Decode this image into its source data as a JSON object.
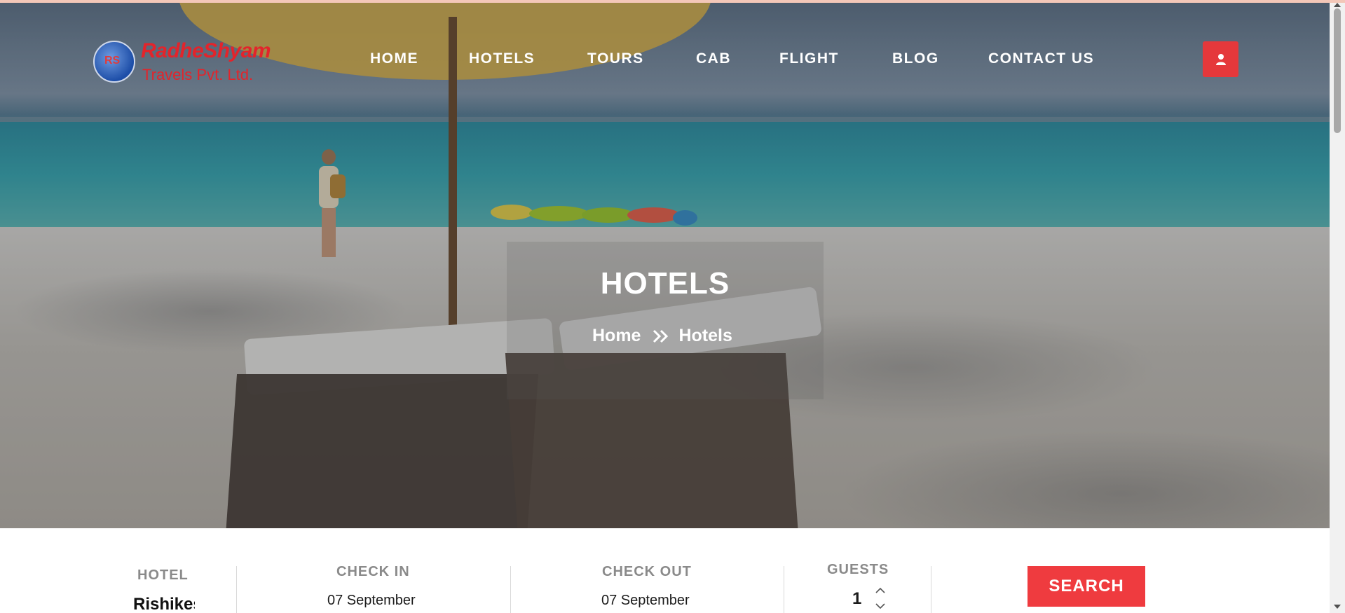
{
  "brand": {
    "name": "RadheShyam",
    "subtitle": "Travels Pvt. Ltd.",
    "color": "#e3242b"
  },
  "nav": {
    "items": [
      {
        "label": "HOME"
      },
      {
        "label": "HOTELS"
      },
      {
        "label": "TOURS"
      },
      {
        "label": "CAB"
      },
      {
        "label": "FLIGHT"
      },
      {
        "label": "BLOG"
      },
      {
        "label": "CONTACT US"
      }
    ],
    "user_icon": "user-icon",
    "accent": "#e5383b"
  },
  "hero": {
    "title": "HOTELS",
    "breadcrumb": {
      "home": "Home",
      "separator_icon": "double-chevron-right-icon",
      "current": "Hotels"
    }
  },
  "search": {
    "hotel": {
      "label": "HOTEL",
      "value": "Rishikesh"
    },
    "check_in": {
      "label": "CHECK IN",
      "value": "07 September"
    },
    "check_out": {
      "label": "CHECK OUT",
      "value": "07 September"
    },
    "guests": {
      "label": "GUESTS",
      "value": "1"
    },
    "button_label": "SEARCH",
    "button_color": "#ef3b3f"
  }
}
